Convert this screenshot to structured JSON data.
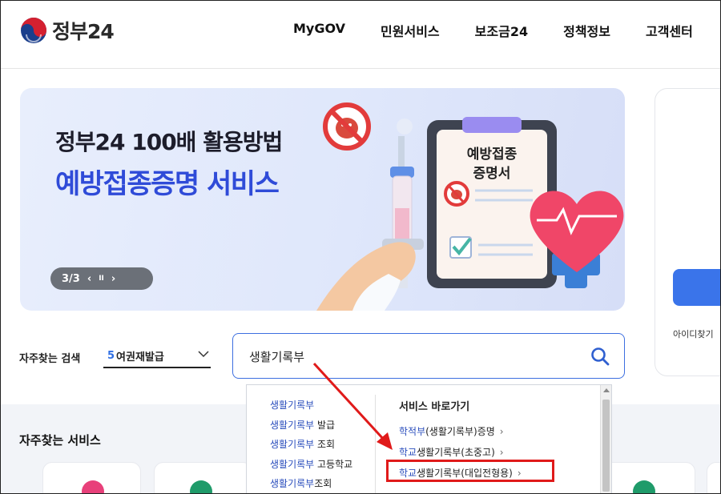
{
  "header": {
    "logo_text": "정부24",
    "nav": [
      "MyGOV",
      "민원서비스",
      "보조금24",
      "정책정보",
      "고객센터"
    ]
  },
  "banner": {
    "title_line1": "정부24 100배 활용방법",
    "title_line2": "예방접종증명 서비스",
    "clipboard_text": "예방접종\n증명서",
    "pager": {
      "current": "3/3",
      "prev": "‹",
      "pause": "II",
      "next": "›"
    }
  },
  "login_card": {
    "link_text": "아이디찾기"
  },
  "frequent_search": {
    "label": "자주찾는 검색",
    "rank": "5",
    "selected": "여권재발급"
  },
  "search": {
    "value": "생활기록부"
  },
  "autocomplete": {
    "suggestions": [
      {
        "highlight": "생활기록부",
        "rest": ""
      },
      {
        "highlight": "생활기록부",
        "rest": " 발급"
      },
      {
        "highlight": "생활기록부",
        "rest": " 조회"
      },
      {
        "highlight": "생활기록부",
        "rest": " 고등학교"
      },
      {
        "highlight": "생활기록부",
        "rest": "조회"
      }
    ],
    "shortcut_heading": "서비스 바로가기",
    "shortcuts": [
      {
        "pre": "",
        "highlight": "학적부",
        "post": "(생활기록부)증명"
      },
      {
        "pre": "",
        "highlight": "학교",
        "post": "생활기록부(초중고)"
      },
      {
        "pre": "",
        "highlight": "학교",
        "post": "생활기록부(대입전형용)"
      }
    ],
    "chevron": "›"
  },
  "frequent_services": {
    "title": "자주찾는 서비스",
    "badge_colors": [
      "#e8407a",
      "#1f9b6a",
      "#1f9b6a"
    ]
  },
  "colors": {
    "accent": "#2f4bd8",
    "search_border": "#3d6fe0",
    "annotation": "#e01a1a"
  }
}
